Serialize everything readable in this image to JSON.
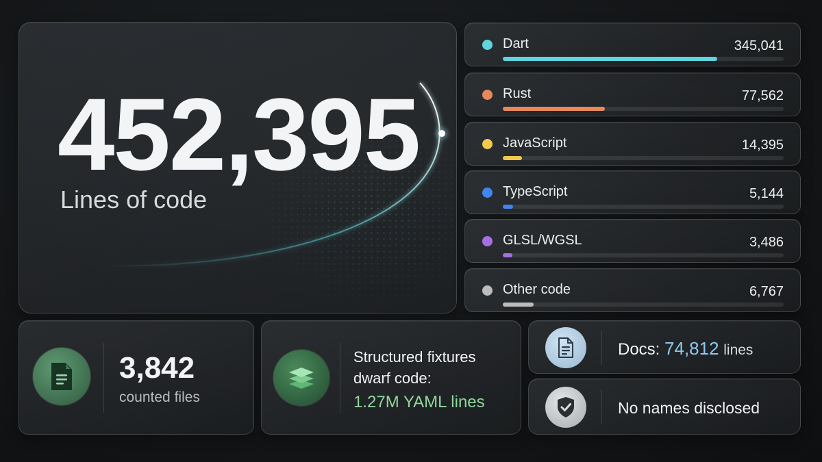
{
  "hero": {
    "total": "452,395",
    "label": "Lines of code"
  },
  "languages": [
    {
      "name": "Dart",
      "value": "345,041",
      "color": "#5fd6dd",
      "fraction": 0.763
    },
    {
      "name": "Rust",
      "value": "77,562",
      "color": "#e8895c",
      "fraction": 0.363
    },
    {
      "name": "JavaScript",
      "value": "14,395",
      "color": "#f2c94c",
      "fraction": 0.068
    },
    {
      "name": "TypeScript",
      "value": "5,144",
      "color": "#3f86f0",
      "fraction": 0.037
    },
    {
      "name": "GLSL/WGSL",
      "value": "3,486",
      "color": "#a86ee6",
      "fraction": 0.033
    },
    {
      "name": "Other code",
      "value": "6,767",
      "color": "#bcbcbc",
      "fraction": 0.109
    }
  ],
  "files": {
    "count": "3,842",
    "label": "counted files",
    "icon": "document-icon"
  },
  "fixtures": {
    "line1": "Structured fixtures",
    "line2": "dwarf code:",
    "highlight": "1.27M YAML lines",
    "icon": "layers-icon"
  },
  "docs": {
    "prefix": "Docs:",
    "count": "74,812",
    "suffix": "lines",
    "icon": "document-icon"
  },
  "privacy": {
    "label": "No names disclosed",
    "icon": "shield-check-icon"
  }
}
